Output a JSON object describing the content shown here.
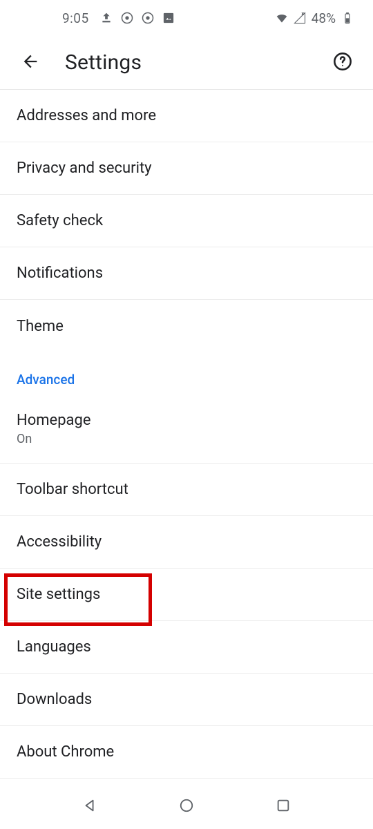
{
  "status_bar": {
    "time": "9:05",
    "battery_text": "48%"
  },
  "app_bar": {
    "title": "Settings"
  },
  "section_header": "Advanced",
  "rows": {
    "addresses": "Addresses and more",
    "privacy": "Privacy and security",
    "safety": "Safety check",
    "notifications": "Notifications",
    "theme": "Theme",
    "homepage_label": "Homepage",
    "homepage_sub": "On",
    "toolbar": "Toolbar shortcut",
    "accessibility": "Accessibility",
    "site_settings": "Site settings",
    "languages": "Languages",
    "downloads": "Downloads",
    "about": "About Chrome"
  },
  "highlight": {
    "target": "site-settings-row"
  }
}
